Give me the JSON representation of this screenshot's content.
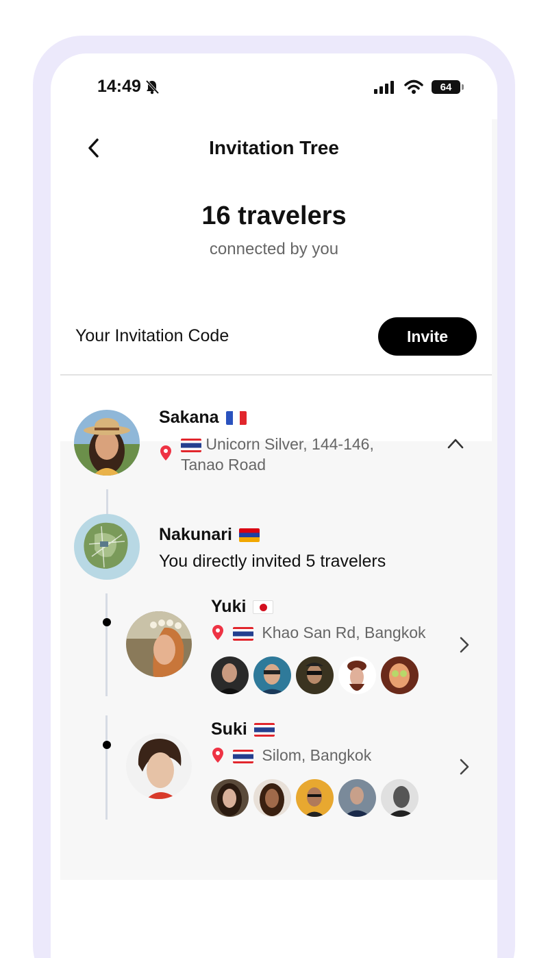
{
  "status": {
    "time": "14:49",
    "battery": "64"
  },
  "header": {
    "title": "Invitation Tree"
  },
  "summary": {
    "count": "16 travelers",
    "subtitle": "connected by you"
  },
  "invitation": {
    "label": "Your Invitation Code",
    "button": "Invite"
  },
  "root": {
    "name": "Sakana",
    "flag": "fr",
    "location_line1": "Unicorn Silver, 144-146,",
    "location_line2": "Tanao Road",
    "location_flag": "th"
  },
  "me": {
    "name": "Nakunari",
    "flag": "am",
    "note": "You directly invited 5 travelers"
  },
  "invitees": [
    {
      "name": "Yuki",
      "flag": "jp",
      "location": "Khao San Rd, Bangkok",
      "location_flag": "th",
      "sub_invitee_count": 5
    },
    {
      "name": "Suki",
      "flag": "th",
      "location": "Silom, Bangkok",
      "location_flag": "th",
      "sub_invitee_count": 5
    }
  ],
  "colors": {
    "accent": "#000000",
    "frame": "#ece9fb",
    "pin": "#ee3344"
  }
}
